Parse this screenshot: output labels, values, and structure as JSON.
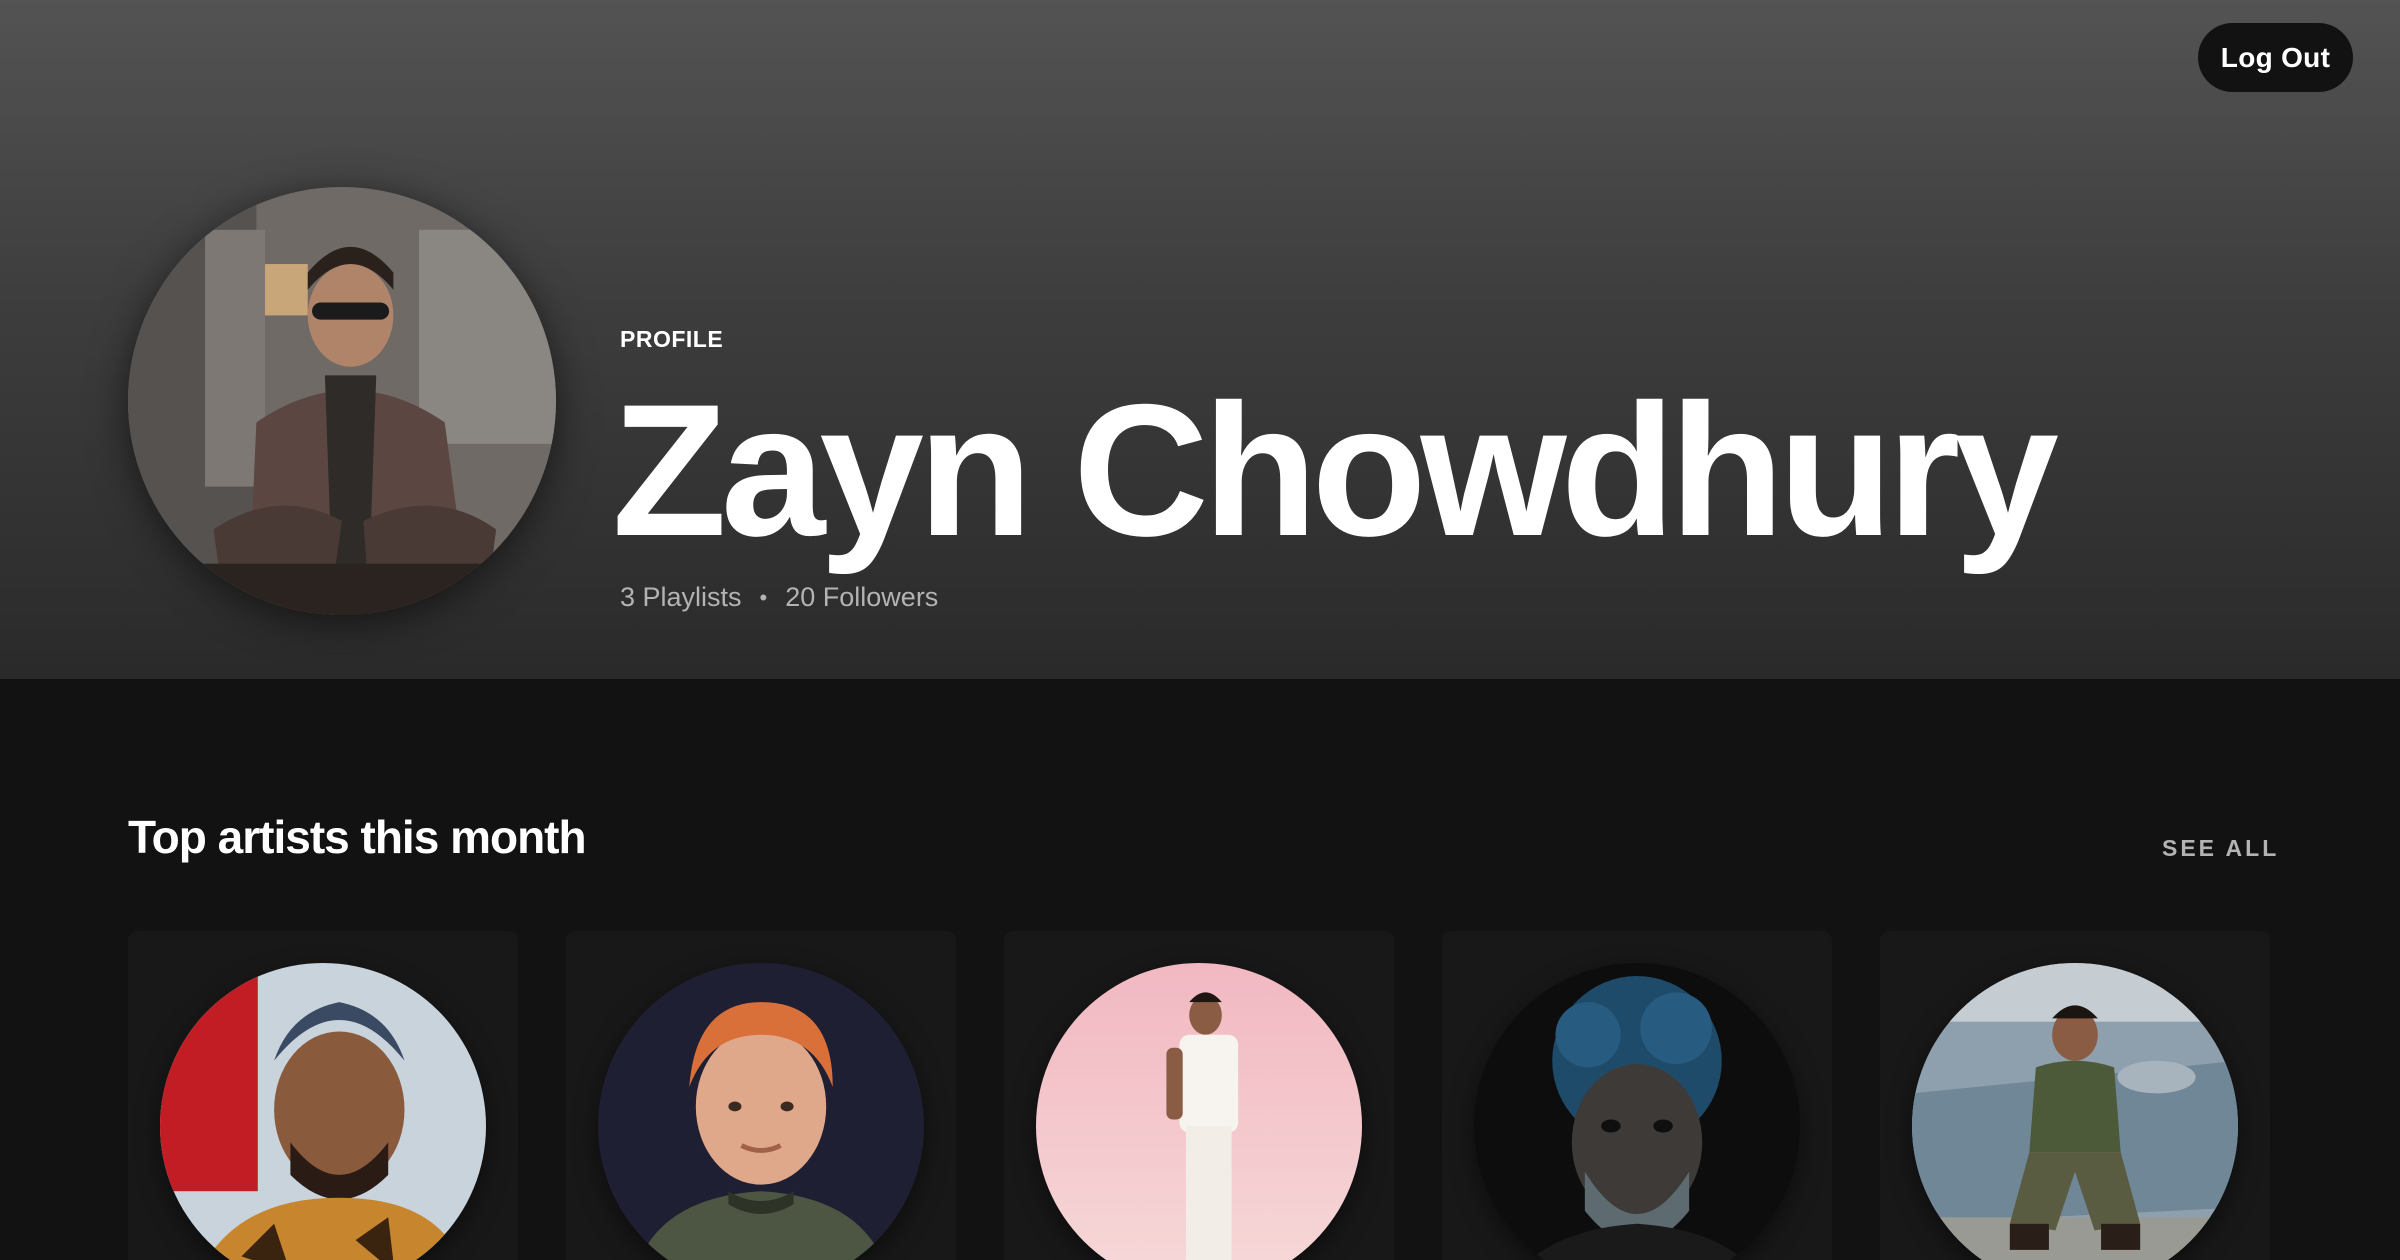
{
  "header": {
    "logout_label": "Log Out",
    "profile_label": "PROFILE",
    "name": "Zayn Chowdhury",
    "stats": {
      "playlists": "3 Playlists",
      "separator": "•",
      "followers": "20 Followers"
    }
  },
  "top_artists": {
    "title": "Top artists this month",
    "see_all_label": "SEE ALL",
    "cards": [
      {
        "icon": "artist-avatar-1"
      },
      {
        "icon": "artist-avatar-2"
      },
      {
        "icon": "artist-avatar-3"
      },
      {
        "icon": "artist-avatar-4"
      },
      {
        "icon": "artist-avatar-5"
      }
    ]
  },
  "colors": {
    "background": "#121212",
    "card": "#181818",
    "header_top": "#535353",
    "muted_text": "#b3b3b3",
    "button_bg": "#121212"
  }
}
